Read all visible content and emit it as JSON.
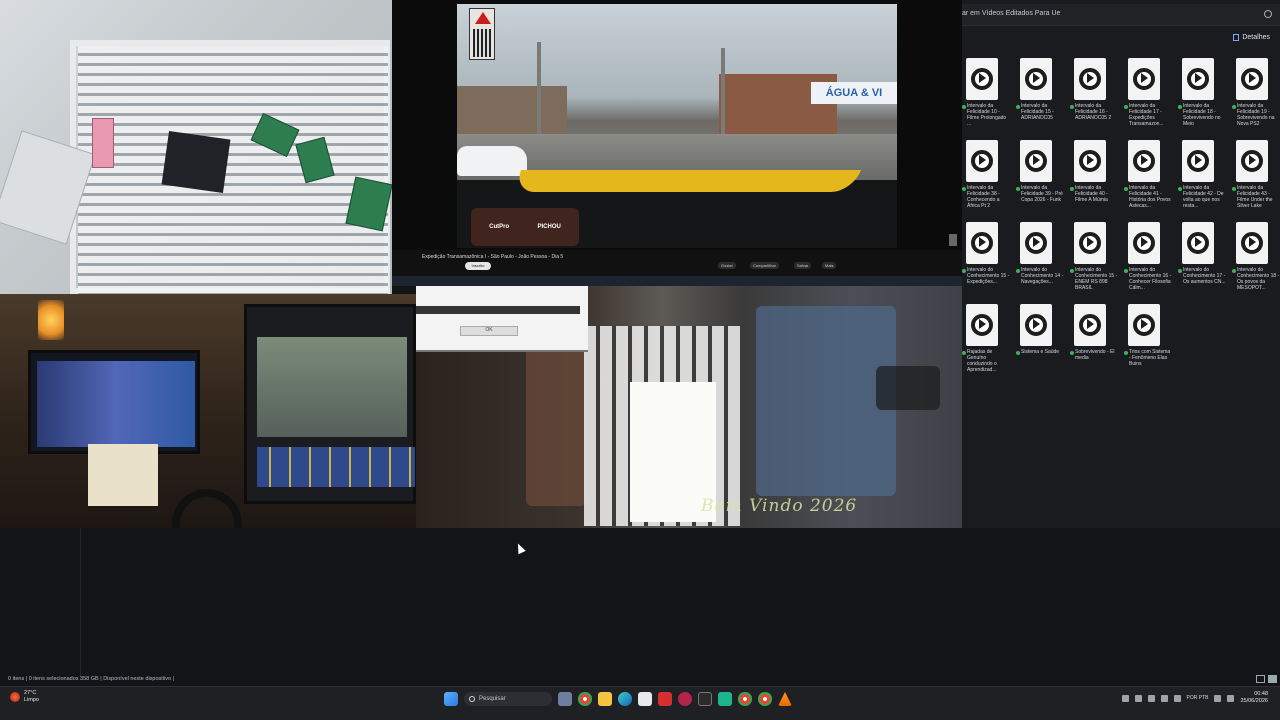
{
  "explorer": {
    "address": "ar em Vídeos Editados Para Ue",
    "details_label": "Detalhes",
    "items": [
      {
        "label": "Intervalo da Felicidade 10 - Filme Prolongado ..."
      },
      {
        "label": "Intervalo da Felicidade 15 - ADRIANOC05"
      },
      {
        "label": "Intervalo da Felicidade 16 - ADRIANOC05 2"
      },
      {
        "label": "Intervalo da Felicidade 17 - Expedições Transamazon..."
      },
      {
        "label": "Intervalo da Felicidade 18 - Sobrevivendo no Meio"
      },
      {
        "label": "Intervalo da Felicidade 19 - Sobrevivendo na Nova PS2"
      },
      {
        "label": "Intervalo da Felicidade 38 - Conhecendo a África Pt 2"
      },
      {
        "label": "Intervalo da Felicidade 39 - Pré Copa 2026 - Funk"
      },
      {
        "label": "Intervalo da Felicidade 40 - Filme A Múmia"
      },
      {
        "label": "Intervalo da Felicidade 41 - História dos Povos Astecas..."
      },
      {
        "label": "Intervalo da Felicidade 42 - De volta ao que nos resta..."
      },
      {
        "label": "Intervalo da Felicidade 43 - Filme Under the Silver Lake"
      },
      {
        "label": "Intervalo do Conhecimento 15 - Expedições..."
      },
      {
        "label": "Intervalo do Conhecimento 14 - Navegações..."
      },
      {
        "label": "Intervalo do Conhecimento 15 - ENEM RS 898 BRASIL"
      },
      {
        "label": "Intervalo do Conhecimento 16 - Conhecer Filosofia Cálm..."
      },
      {
        "label": "Intervalo do Conhecimento 17 - Os aumentos CN..."
      },
      {
        "label": "Intervalo do Conhecimento 18 - Os povos da MESOPOT..."
      },
      {
        "label": "Rajadas de Genuíno conduzindo o Aprendizad..."
      },
      {
        "label": "Sistema e Saúde"
      },
      {
        "label": "Sobrevivendo - El media"
      },
      {
        "label": "Trios com Sistema - Fenômeno Elas Buins"
      }
    ]
  },
  "player": {
    "title": "Expedição Transamazônica I - São Paulo - João Pessoa - Dia 5",
    "subscribe": "Inscrito",
    "chips": [
      "Gostei",
      "Compartilhar",
      "Salvar",
      "Mais"
    ],
    "sign_text": "ÁGUA & VI",
    "badge_labels": [
      "PICHOU",
      "CutPro"
    ]
  },
  "cam_room": {
    "watermark": "Bem Vindo 2026",
    "dialog_button": "OK"
  },
  "statusbar": {
    "text": "0 itens  |  0 itens selecionados  358 GB  |  Disponível neste dispositivo  |"
  },
  "taskbar": {
    "weather_temp": "27°C",
    "weather_desc": "Limpo",
    "search_placeholder": "Pesquisar",
    "lang": "POR PTB",
    "time": "00:48",
    "date": "25/06/2026"
  },
  "colors": {
    "accent": "#2a78e0",
    "status_green": "#3bb35a"
  }
}
